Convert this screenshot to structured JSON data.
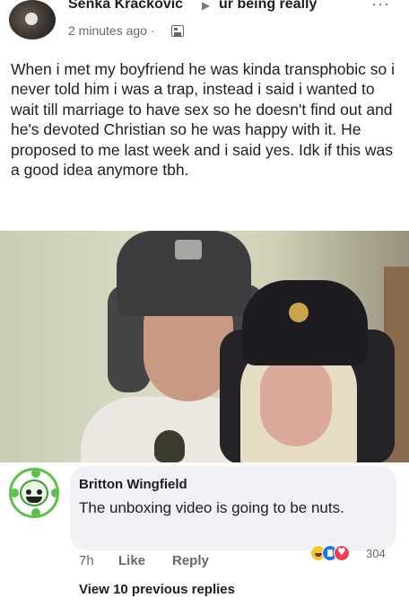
{
  "post": {
    "author": "Senka Kračković",
    "group": "ur being really",
    "timestamp": "2 minutes ago ·",
    "text": "When i met my boyfriend he was kinda transphobic so i never told him i was a trap, instead i said i wanted to wait till marriage to have sex so he doesn't find out and he's devoted Christian so he was happy with it. He proposed to me last week  and i said yes. Idk if this was a good idea anymore tbh."
  },
  "icons": {
    "arrow": "right-arrow-icon",
    "more": "more-options-icon",
    "audience": "audience-icon",
    "reactions": [
      "haha-reaction-icon",
      "like-reaction-icon",
      "love-reaction-icon"
    ]
  },
  "comment": {
    "author": "Britton Wingfield",
    "text": "The unboxing video is going to be nuts.",
    "time": "7h",
    "like_label": "Like",
    "reply_label": "Reply",
    "reaction_count": "304"
  },
  "view_replies_label": "View 10 previous replies",
  "colors": {
    "text": "#1c1e21",
    "secondary": "#65676b",
    "bubble": "#f0f2f5",
    "like_blue": "#1877f2",
    "love_red": "#f33e58",
    "haha_yellow": "#f7c32e"
  }
}
